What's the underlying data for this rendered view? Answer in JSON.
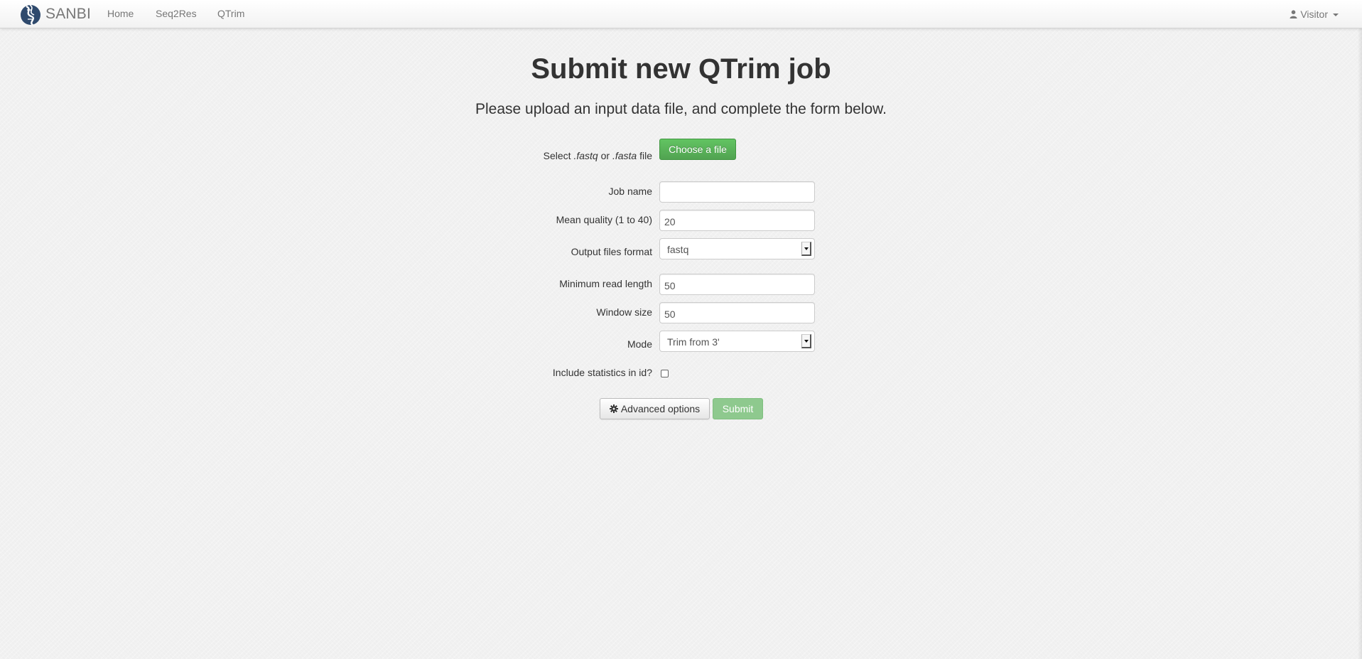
{
  "navbar": {
    "brand": "SANBI",
    "links": [
      {
        "label": "Home"
      },
      {
        "label": "Seq2Res"
      },
      {
        "label": "QTrim"
      }
    ],
    "user": {
      "label": "Visitor",
      "icon": "user-icon"
    }
  },
  "page": {
    "title": "Submit new QTrim job",
    "lead": "Please upload an input data file, and complete the form below."
  },
  "form": {
    "file": {
      "label_prefix": "Select",
      "label_ext1": ".fastq",
      "label_or": "or",
      "label_ext2": ".fasta",
      "label_suffix": "file",
      "button_label": "Choose a file"
    },
    "job_name": {
      "label": "Job name",
      "value": ""
    },
    "mean_quality": {
      "label": "Mean quality (1 to 40)",
      "value": "20"
    },
    "output_format": {
      "label": "Output files format",
      "selected": "fastq"
    },
    "min_read_length": {
      "label": "Minimum read length",
      "value": "50"
    },
    "window_size": {
      "label": "Window size",
      "value": "50"
    },
    "mode": {
      "label": "Mode",
      "selected": "Trim from 3'"
    },
    "include_stats": {
      "label": "Include statistics in id?",
      "checked": false
    },
    "advanced_button_label": "Advanced options",
    "submit_label": "Submit"
  },
  "colors": {
    "success": "#5bb75b",
    "submit_disabled": "#8ec98e",
    "navbar_text": "#777777",
    "background": "#f1f1f1"
  }
}
